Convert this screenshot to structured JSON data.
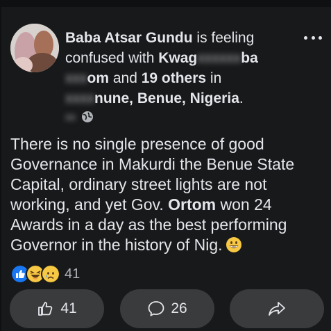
{
  "post": {
    "author": "Baba Atsar Gundu",
    "activity_prefix": " is feeling confused with ",
    "tag_visible_1": "Kwag",
    "tag_visible_2": "ba",
    "tag_visible_3": "om",
    "with_others_join": " and ",
    "others_count": "19 others",
    "location_prefix": " in",
    "location_visible": "nune, Benue, Nigeria",
    "location_suffix": ".",
    "body_part1": "There is no single presence of good Governance in Makurdi the Benue State Capital, ordinary street lights are not working, and yet Gov. ",
    "body_bold": "Ortom",
    "body_part2": " won 24 Awards in a day as the best performing Governor in the history of Nig.",
    "privacy_icon": "globe-icon",
    "more_icon": "more-options-icon"
  },
  "reactions": {
    "types": [
      "like",
      "haha",
      "sad"
    ],
    "count": "41"
  },
  "actions": {
    "like_count": "41",
    "comment_count": "26",
    "like_icon": "thumbs-up-icon",
    "comment_icon": "comment-icon",
    "share_icon": "share-icon"
  },
  "colors": {
    "background": "#18191a",
    "text": "#e4e6eb",
    "secondary_text": "#b0b3b8",
    "button_bg": "#3a3b3c",
    "like_blue": "#1877f2",
    "emoji_yellow": "#f7c843"
  }
}
